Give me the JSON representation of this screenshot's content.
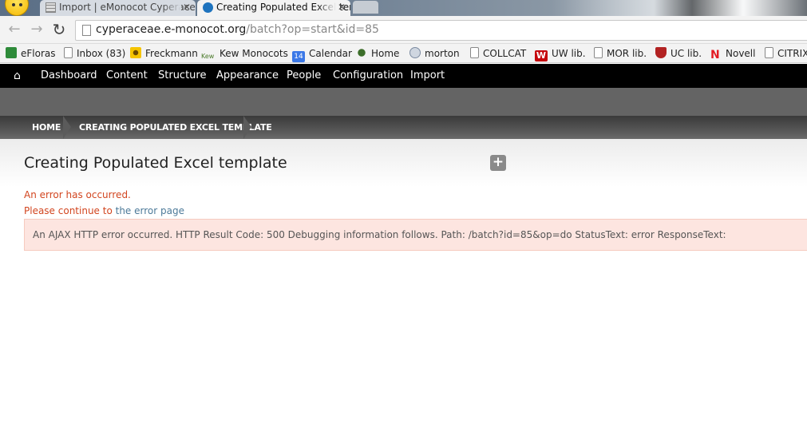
{
  "browser": {
    "tabs": [
      {
        "label": "Import | eMonocot Cyperaceae",
        "close": "✕"
      },
      {
        "label": "Creating Populated Excel template",
        "close": "✕"
      }
    ],
    "url_host": "cyperaceae.e-monocot.org",
    "url_path": "/batch?op=start&id=85",
    "nav": {
      "back": "←",
      "forward": "→",
      "reload": "↻"
    }
  },
  "bookmarks": [
    {
      "label": "eFloras",
      "icon": "efloras-icon",
      "color": "#2e8b3a"
    },
    {
      "label": "Inbox (83)",
      "icon": "page-icon",
      "color": "#ffffff"
    },
    {
      "label": "Freckmann",
      "icon": "flower-icon",
      "color": "#d9b400"
    },
    {
      "label": "Kew Monocots",
      "icon": "kew-icon",
      "color": "#4a7a2a"
    },
    {
      "label": "Calendar",
      "icon": "calendar-icon",
      "color": "#3b78e7"
    },
    {
      "label": "Home",
      "icon": "leaf-icon",
      "color": "#3c6e2a"
    },
    {
      "label": "morton",
      "icon": "r-icon",
      "color": "#7b8aa0"
    },
    {
      "label": "COLLCAT",
      "icon": "page-icon",
      "color": "#ffffff"
    },
    {
      "label": "UW lib.",
      "icon": "uw-icon",
      "color": "#c5050c"
    },
    {
      "label": "MOR lib.",
      "icon": "page-icon",
      "color": "#ffffff"
    },
    {
      "label": "UC lib.",
      "icon": "crest-icon",
      "color": "#b22222"
    },
    {
      "label": "Novell",
      "icon": "novell-icon",
      "color": "#e31b23"
    },
    {
      "label": "CITRIX",
      "icon": "page-icon",
      "color": "#ffffff"
    }
  ],
  "calendar_day": "14",
  "admin_menu": [
    "Dashboard",
    "Content",
    "Structure",
    "Appearance",
    "People",
    "Configuration",
    "Import"
  ],
  "breadcrumb": [
    "HOME",
    "CREATING POPULATED EXCEL TEMPLATE"
  ],
  "page": {
    "title": "Creating Populated Excel template",
    "plus": "+",
    "error_line": "An error has occurred.",
    "continue_prefix": "Please continue to ",
    "continue_link": "the error page",
    "error_message": "An AJAX HTTP error occurred. HTTP Result Code: 500 Debugging information follows. Path: /batch?id=85&op=do StatusText: error ResponseText:"
  }
}
